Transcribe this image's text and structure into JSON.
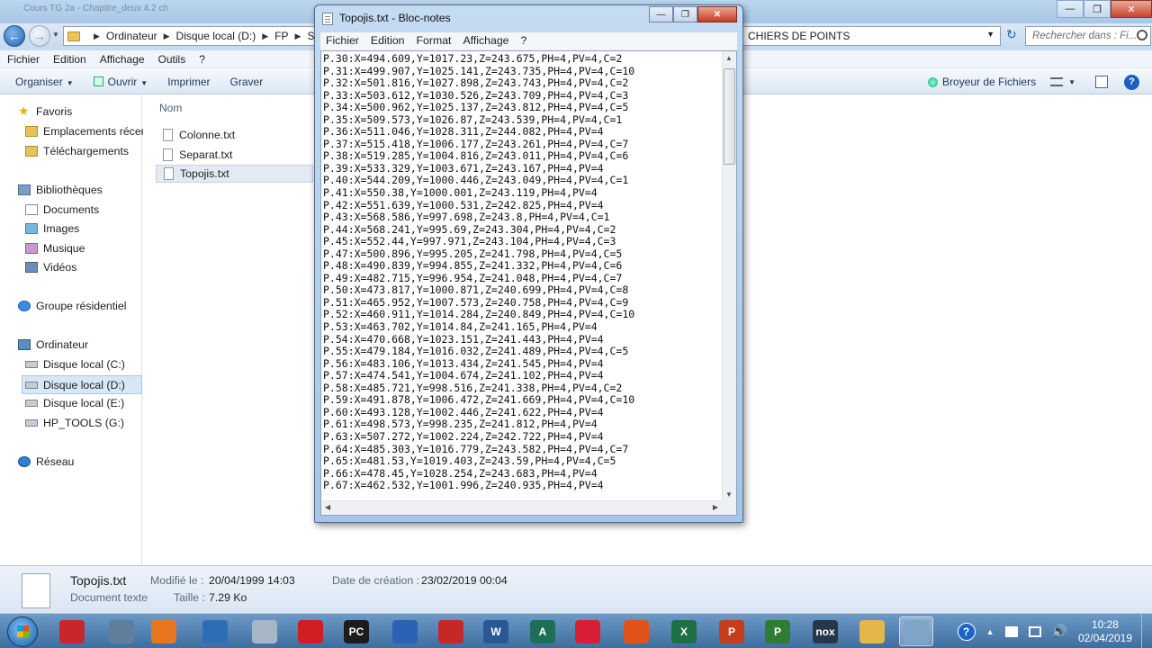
{
  "explorer": {
    "title_blur": "Cours TG 2a - Chapitre_deux 4.2 ch",
    "address": {
      "crumbs": [
        "Ordinateur",
        "Disque local (D:)",
        "FP",
        "SPE"
      ],
      "tail": "CHIERS DE POINTS"
    },
    "search_placeholder": "Rechercher dans : Fi...",
    "menu": [
      "Fichier",
      "Edition",
      "Affichage",
      "Outils",
      "?"
    ],
    "commands": {
      "organize": "Organiser",
      "open": "Ouvrir",
      "print": "Imprimer",
      "burn": "Graver",
      "browser": "Broyeur de Fichiers"
    },
    "nav": {
      "favorites": "Favoris",
      "recent": "Emplacements récents",
      "downloads": "Téléchargements",
      "libraries": "Bibliothèques",
      "documents": "Documents",
      "images": "Images",
      "music": "Musique",
      "videos": "Vidéos",
      "homegroup": "Groupe résidentiel",
      "computer": "Ordinateur",
      "drive_c": "Disque local (C:)",
      "drive_d": "Disque local (D:)",
      "drive_e": "Disque local (E:)",
      "drive_g": "HP_TOOLS (G:)",
      "network": "Réseau"
    },
    "column_name": "Nom",
    "files": [
      "Colonne.txt",
      "Separat.txt",
      "Topojis.txt"
    ],
    "details": {
      "name": "Topojis.txt",
      "type": "Document texte",
      "modified_label": "Modifié le :",
      "modified_value": "20/04/1999 14:03",
      "size_label": "Taille :",
      "size_value": "7.29 Ko",
      "created_label": "Date de création :",
      "created_value": "23/02/2019 00:04"
    }
  },
  "notepad": {
    "title": "Topojis.txt - Bloc-notes",
    "menu": [
      "Fichier",
      "Edition",
      "Format",
      "Affichage",
      "?"
    ],
    "lines": [
      "P.30:X=494.609,Y=1017.23,Z=243.675,PH=4,PV=4,C=2",
      "P.31:X=499.907,Y=1025.141,Z=243.735,PH=4,PV=4,C=10",
      "P.32:X=501.816,Y=1027.898,Z=243.743,PH=4,PV=4,C=2",
      "P.33:X=503.612,Y=1030.526,Z=243.709,PH=4,PV=4,C=3",
      "P.34:X=500.962,Y=1025.137,Z=243.812,PH=4,PV=4,C=5",
      "P.35:X=509.573,Y=1026.87,Z=243.539,PH=4,PV=4,C=1",
      "P.36:X=511.046,Y=1028.311,Z=244.082,PH=4,PV=4",
      "P.37:X=515.418,Y=1006.177,Z=243.261,PH=4,PV=4,C=7",
      "P.38:X=519.285,Y=1004.816,Z=243.011,PH=4,PV=4,C=6",
      "P.39:X=533.329,Y=1003.671,Z=243.167,PH=4,PV=4",
      "P.40:X=544.209,Y=1000.446,Z=243.049,PH=4,PV=4,C=1",
      "P.41:X=550.38,Y=1000.001,Z=243.119,PH=4,PV=4",
      "P.42:X=551.639,Y=1000.531,Z=242.825,PH=4,PV=4",
      "P.43:X=568.586,Y=997.698,Z=243.8,PH=4,PV=4,C=1",
      "P.44:X=568.241,Y=995.69,Z=243.304,PH=4,PV=4,C=2",
      "P.45:X=552.44,Y=997.971,Z=243.104,PH=4,PV=4,C=3",
      "P.47:X=500.896,Y=995.205,Z=241.798,PH=4,PV=4,C=5",
      "P.48:X=490.839,Y=994.855,Z=241.332,PH=4,PV=4,C=6",
      "P.49:X=482.715,Y=996.954,Z=241.048,PH=4,PV=4,C=7",
      "P.50:X=473.817,Y=1000.871,Z=240.699,PH=4,PV=4,C=8",
      "P.51:X=465.952,Y=1007.573,Z=240.758,PH=4,PV=4,C=9",
      "P.52:X=460.911,Y=1014.284,Z=240.849,PH=4,PV=4,C=10",
      "P.53:X=463.702,Y=1014.84,Z=241.165,PH=4,PV=4",
      "P.54:X=470.668,Y=1023.151,Z=241.443,PH=4,PV=4",
      "P.55:X=479.184,Y=1016.032,Z=241.489,PH=4,PV=4,C=5",
      "P.56:X=483.106,Y=1013.434,Z=241.545,PH=4,PV=4",
      "P.57:X=474.541,Y=1004.674,Z=241.102,PH=4,PV=4",
      "P.58:X=485.721,Y=998.516,Z=241.338,PH=4,PV=4,C=2",
      "P.59:X=491.878,Y=1006.472,Z=241.669,PH=4,PV=4,C=10",
      "P.60:X=493.128,Y=1002.446,Z=241.622,PH=4,PV=4",
      "P.61:X=498.573,Y=998.235,Z=241.812,PH=4,PV=4",
      "P.63:X=507.272,Y=1002.224,Z=242.722,PH=4,PV=4",
      "P.64:X=485.303,Y=1016.779,Z=243.582,PH=4,PV=4,C=7",
      "P.65:X=481.53,Y=1019.403,Z=243.59,PH=4,PV=4,C=5",
      "P.66:X=478.45,Y=1028.254,Z=243.683,PH=4,PV=4",
      "P.67:X=462.532,Y=1001.996,Z=240.935,PH=4,PV=4"
    ]
  },
  "taskbar": {
    "apps": [
      {
        "name": "vlc-icon",
        "label": "",
        "color": "#c8262b"
      },
      {
        "name": "keyboard-icon",
        "label": "",
        "color": "#5f7e9c"
      },
      {
        "name": "media-player-icon",
        "label": "",
        "color": "#e8761f"
      },
      {
        "name": "ccleaner-icon",
        "label": "",
        "color": "#2d6db5"
      },
      {
        "name": "snipping-tool-icon",
        "label": "",
        "color": "#a7b6c7"
      },
      {
        "name": "opera-icon",
        "label": "",
        "color": "#d31d24"
      },
      {
        "name": "pycharm-icon",
        "label": "PC",
        "color": "#1c1c1c"
      },
      {
        "name": "google-earth-icon",
        "label": "",
        "color": "#2b62b4"
      },
      {
        "name": "bandicam-icon",
        "label": "",
        "color": "#c62828"
      },
      {
        "name": "word-icon",
        "label": "W",
        "color": "#2b5797"
      },
      {
        "name": "autocad-icon",
        "label": "A",
        "color": "#1f6f57"
      },
      {
        "name": "covadis-icon",
        "label": "",
        "color": "#d81e32"
      },
      {
        "name": "firefox-icon",
        "label": "",
        "color": "#e2531a"
      },
      {
        "name": "excel-icon",
        "label": "X",
        "color": "#1e7145"
      },
      {
        "name": "powerpoint-icon",
        "label": "P",
        "color": "#c43e1c"
      },
      {
        "name": "project-icon",
        "label": "P",
        "color": "#2f7d32"
      },
      {
        "name": "nox-icon",
        "label": "nox",
        "color": "#26374a"
      },
      {
        "name": "explorer-icon",
        "label": "",
        "color": "#e4b64b"
      },
      {
        "name": "notepad-icon",
        "label": "",
        "color": "#7fa6c9"
      }
    ],
    "time": "10:28",
    "date": "02/04/2019"
  }
}
